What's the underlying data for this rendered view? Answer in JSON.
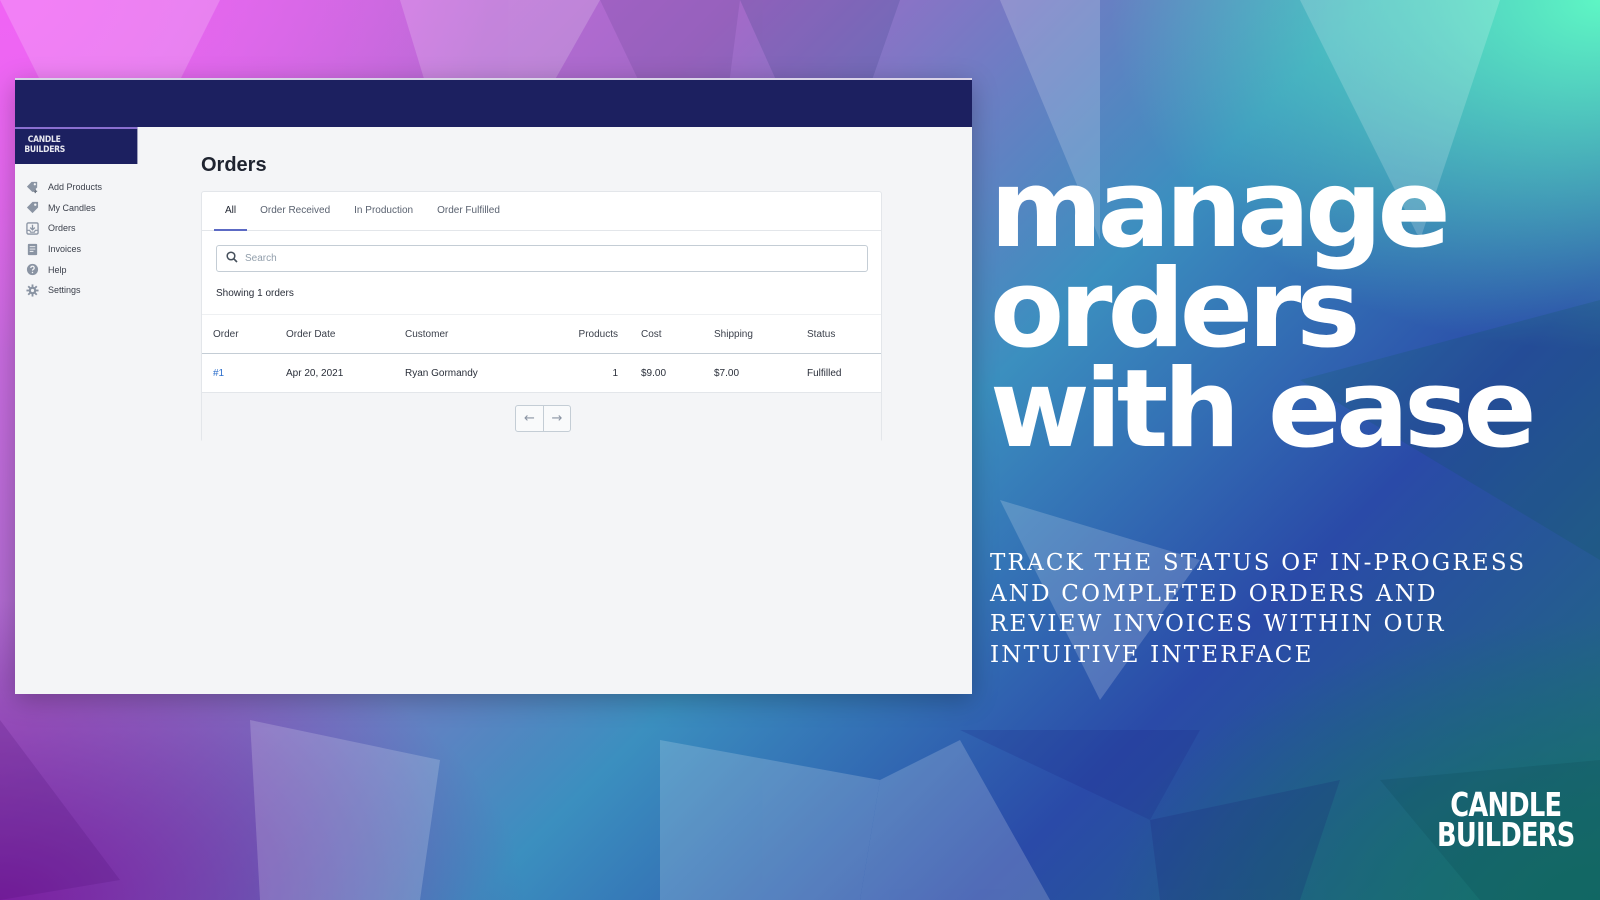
{
  "app": {
    "brand": {
      "line1": "CANDLE",
      "line2": "BUILDERS"
    },
    "sidebar": {
      "items": [
        {
          "label": "Add Products",
          "icon": "tag-plus-icon"
        },
        {
          "label": "My Candles",
          "icon": "tag-icon"
        },
        {
          "label": "Orders",
          "icon": "inbox-download-icon"
        },
        {
          "label": "Invoices",
          "icon": "document-icon"
        },
        {
          "label": "Help",
          "icon": "question-circle-icon"
        },
        {
          "label": "Settings",
          "icon": "gear-icon"
        }
      ]
    },
    "main": {
      "title": "Orders",
      "tabs": [
        {
          "label": "All",
          "active": true
        },
        {
          "label": "Order Received",
          "active": false
        },
        {
          "label": "In Production",
          "active": false
        },
        {
          "label": "Order Fulfilled",
          "active": false
        }
      ],
      "search": {
        "placeholder": "Search",
        "value": ""
      },
      "showing": "Showing 1 orders",
      "table": {
        "columns": [
          "Order",
          "Order Date",
          "Customer",
          "Products",
          "Cost",
          "Shipping",
          "Status"
        ],
        "rows": [
          {
            "order": "#1",
            "date": "Apr 20, 2021",
            "customer": "Ryan Gormandy",
            "products": "1",
            "cost": "$9.00",
            "shipping": "$7.00",
            "status": "Fulfilled"
          }
        ]
      },
      "pagination": {
        "prev": "←",
        "next": "→"
      }
    },
    "colors": {
      "topbar": "#1c2060",
      "accent": "#5c6ac4",
      "link": "#2c6ecb"
    }
  },
  "promo": {
    "headline": [
      "manage",
      "orders",
      "with ease"
    ],
    "subtext": "Track the status of in-progress and completed orders and review invoices within our intuitive interface",
    "logo": {
      "line1": "CANDLE",
      "line2": "BUILDERS"
    }
  }
}
